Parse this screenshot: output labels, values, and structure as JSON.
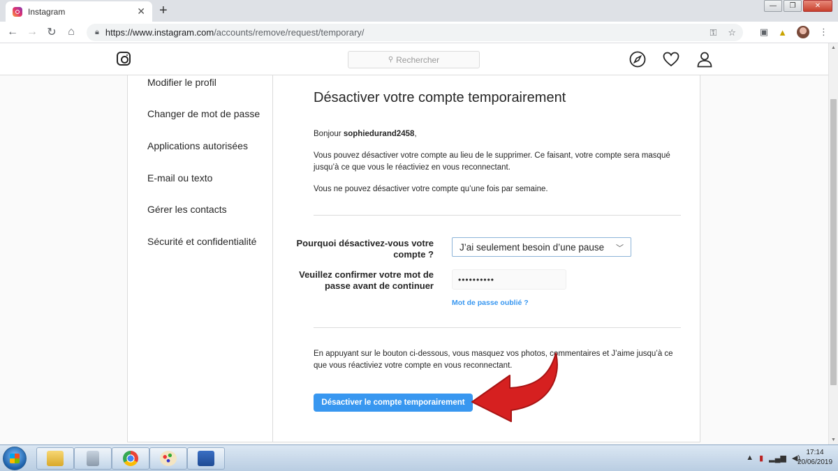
{
  "browser": {
    "tab_title": "Instagram",
    "tab_close": "✕",
    "new_tab": "+",
    "url_host": "https://www.instagram.com",
    "url_path": "/accounts/remove/request/temporary/",
    "window_controls": [
      "—",
      "❐",
      "✕"
    ]
  },
  "header": {
    "search_placeholder": "Rechercher"
  },
  "sidebar": {
    "items": [
      {
        "label": "Modifier le profil"
      },
      {
        "label": "Changer de mot de passe"
      },
      {
        "label": "Applications autorisées"
      },
      {
        "label": "E-mail ou texto"
      },
      {
        "label": "Gérer les contacts"
      },
      {
        "label": "Sécurité et confidentialité"
      }
    ]
  },
  "main": {
    "title": "Désactiver votre compte temporairement",
    "greeting_prefix": "Bonjour ",
    "username": "sophiedurand2458",
    "greeting_suffix": ",",
    "para1": "Vous pouvez désactiver votre compte au lieu de le supprimer. Ce faisant, votre compte sera masqué jusqu’à ce que vous le réactiviez en vous reconnectant.",
    "para2": "Vous ne pouvez désactiver votre compte qu’une fois par semaine.",
    "reason_label": "Pourquoi désactivez-vous votre compte ?",
    "reason_value": "J’ai seulement besoin d’une pause",
    "password_label": "Veuillez confirmer votre mot de passe avant de continuer",
    "password_value": "••••••••••",
    "forgot_link": "Mot de passe oublié ?",
    "footer_text": "En appuyant sur le bouton ci-dessous, vous masquez vos photos, commentaires et J’aime jusqu’à ce que vous réactiviez votre compte en vous reconnectant.",
    "submit_button": "Désactiver le compte temporairement"
  },
  "annotation": {
    "arrow_color": "#d62020"
  },
  "taskbar": {
    "time": "17:14",
    "date": "20/06/2019"
  },
  "colors": {
    "accent": "#3897f0",
    "border": "#dbdbdb"
  }
}
